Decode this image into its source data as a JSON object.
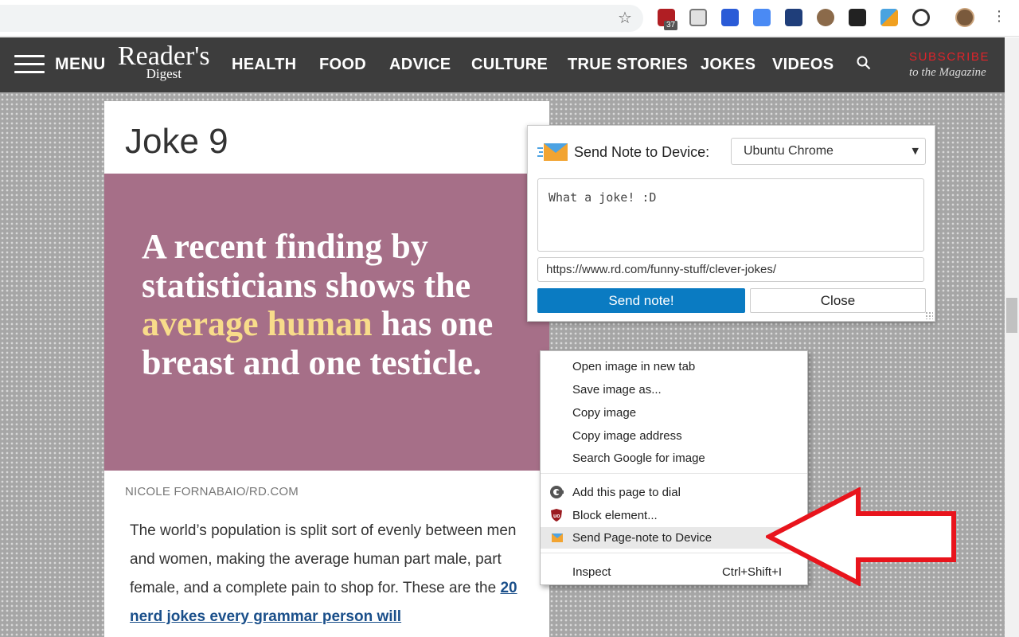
{
  "browser": {
    "extension_badge": "37"
  },
  "header": {
    "menu_label": "MENU",
    "logo_line1": "Reader's",
    "logo_line2": "Digest",
    "nav": [
      "HEALTH",
      "FOOD",
      "ADVICE",
      "CULTURE",
      "TRUE STORIES",
      "JOKES",
      "VIDEOS"
    ],
    "subscribe": "SUBSCRIBE",
    "subscribe_sub": "to the Magazine"
  },
  "article": {
    "title": "Joke 9",
    "card_line1": "A recent finding by",
    "card_line2": "statisticians shows the",
    "card_highlight": "average human",
    "card_line3_rest": " has one",
    "card_line4": "breast and one testicle.",
    "credit": "NICOLE FORNABAIO/RD.COM",
    "body": "The world’s population is split sort of evenly between men and women, making the average human part male, part female, and a complete pain to shop for. These are the ",
    "body_link": "20 nerd jokes every grammar person will"
  },
  "popup": {
    "label": "Send Note to Device:",
    "device": "Ubuntu Chrome",
    "note": "What a joke! :D",
    "url": "https://www.rd.com/funny-stuff/clever-jokes/",
    "send_label": "Send note!",
    "close_label": "Close"
  },
  "context_menu": {
    "group1": [
      "Open image in new tab",
      "Save image as...",
      "Copy image",
      "Copy image address",
      "Search Google for image"
    ],
    "group2": [
      "Add this page to dial",
      "Block element...",
      "Send Page-note to Device"
    ],
    "inspect": "Inspect",
    "inspect_shortcut": "Ctrl+Shift+I"
  },
  "colors": {
    "accent_blue": "#0a7bc2",
    "card_mauve": "#a66f88",
    "highlight_yellow": "#f8dc8a",
    "subscribe_red": "#e0232a",
    "arrow_red": "#e8141c"
  }
}
